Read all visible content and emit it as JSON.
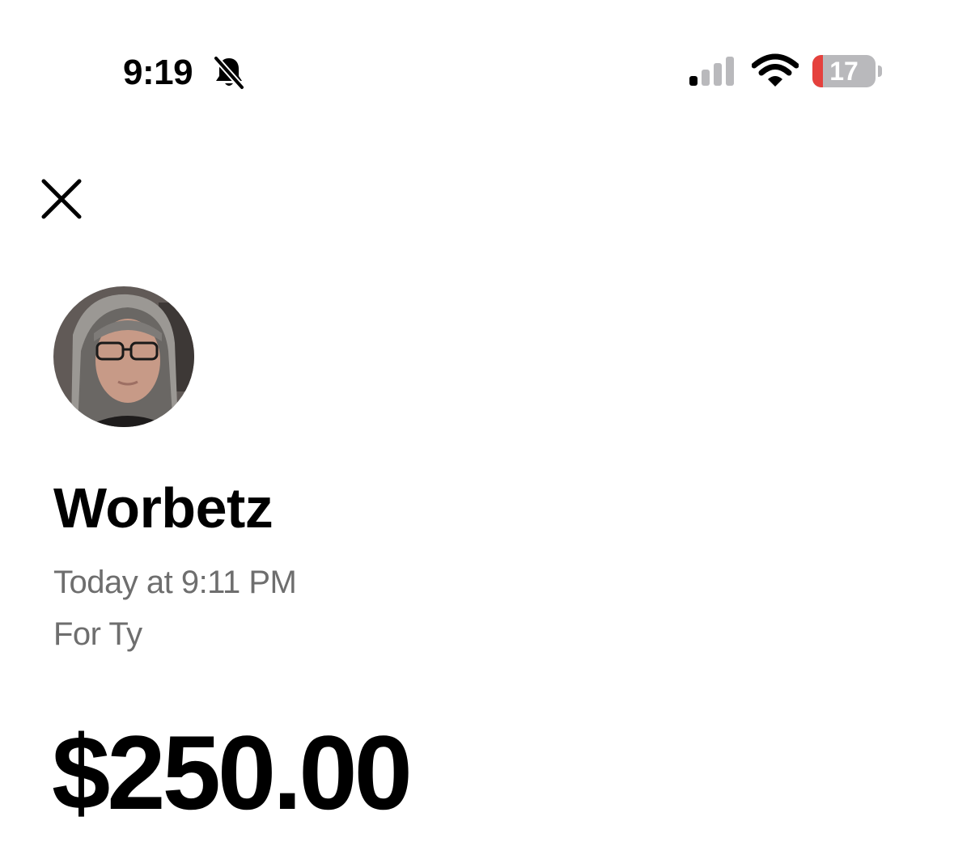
{
  "status_bar": {
    "time": "9:19",
    "silent_icon": "bell-slash-icon",
    "signal_icon": "cellular-signal-icon",
    "signal_bars_active": 1,
    "signal_bars_total": 4,
    "wifi_icon": "wifi-icon",
    "battery_level": "17",
    "battery_fraction": 0.17,
    "battery_low_color": "#e5413d"
  },
  "header": {
    "close_icon": "close-icon"
  },
  "payment": {
    "sender_avatar": "avatar-photo",
    "sender_name": "Worbetz",
    "time": "Today at 9:11 PM",
    "note": "For Ty",
    "amount": "$250.00"
  },
  "colors": {
    "text_primary": "#000000",
    "text_secondary": "#6e6e6e",
    "background": "#ffffff"
  }
}
